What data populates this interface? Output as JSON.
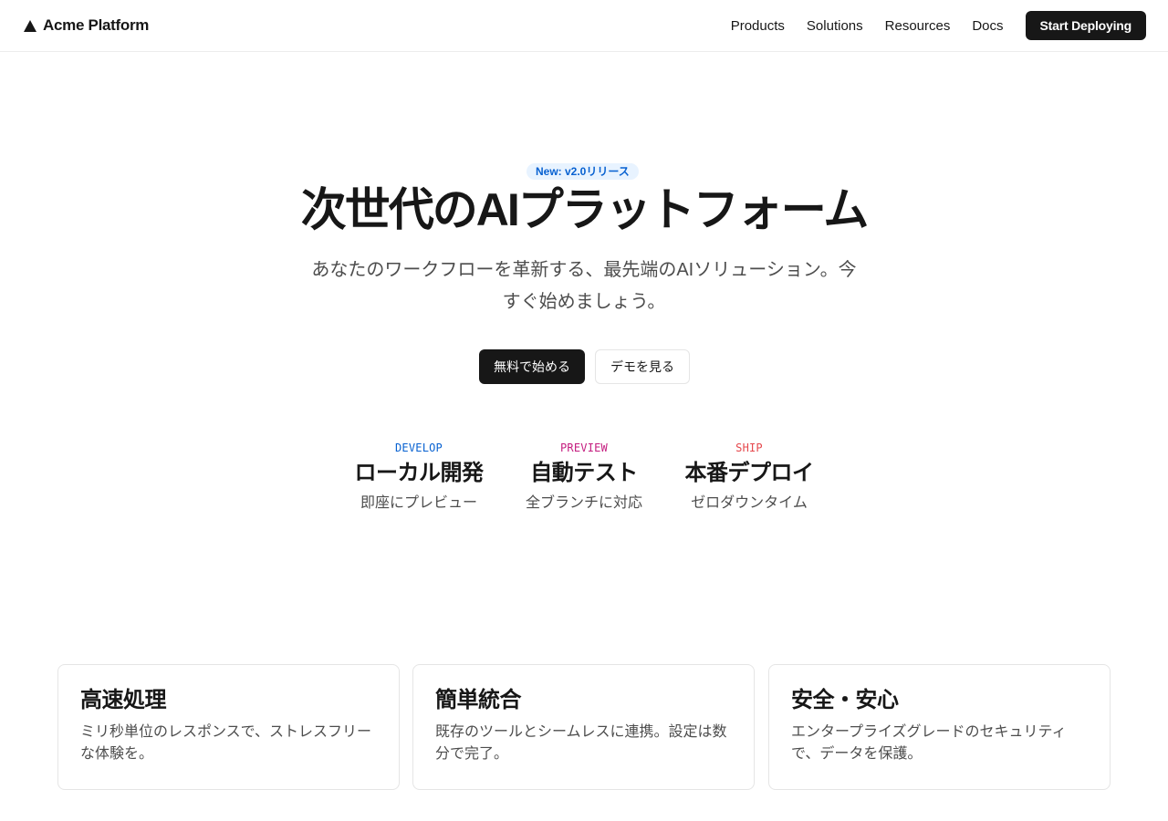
{
  "header": {
    "brand": "Acme Platform",
    "nav": [
      "Products",
      "Solutions",
      "Resources",
      "Docs"
    ],
    "cta": "Start Deploying"
  },
  "hero": {
    "badge": "New: v2.0リリース",
    "title": "次世代のAIプラットフォーム",
    "subtitle": "あなたのワークフローを革新する、最先端のAIソリューション。今すぐ始めましょう。",
    "primary_button": "無料で始める",
    "secondary_button": "デモを見る"
  },
  "steps": [
    {
      "tag": "DEVELOP",
      "title": "ローカル開発",
      "desc": "即座にプレビュー",
      "color": "#0761d1"
    },
    {
      "tag": "PREVIEW",
      "title": "自動テスト",
      "desc": "全ブランチに対応",
      "color": "#c41d7f"
    },
    {
      "tag": "SHIP",
      "title": "本番デプロイ",
      "desc": "ゼロダウンタイム",
      "color": "#e5484d"
    }
  ],
  "features": [
    {
      "title": "高速処理",
      "desc": "ミリ秒単位のレスポンスで、ストレスフリーな体験を。"
    },
    {
      "title": "簡単統合",
      "desc": "既存のツールとシームレスに連携。設定は数分で完了。"
    },
    {
      "title": "安全・安心",
      "desc": "エンタープライズグレードのセキュリティで、データを保護。"
    }
  ],
  "colors": {
    "text": "#171717",
    "muted": "#4d4d4d",
    "badge_bg": "#e8f3ff",
    "badge_text": "#0761d1",
    "border": "#e5e5e5"
  }
}
